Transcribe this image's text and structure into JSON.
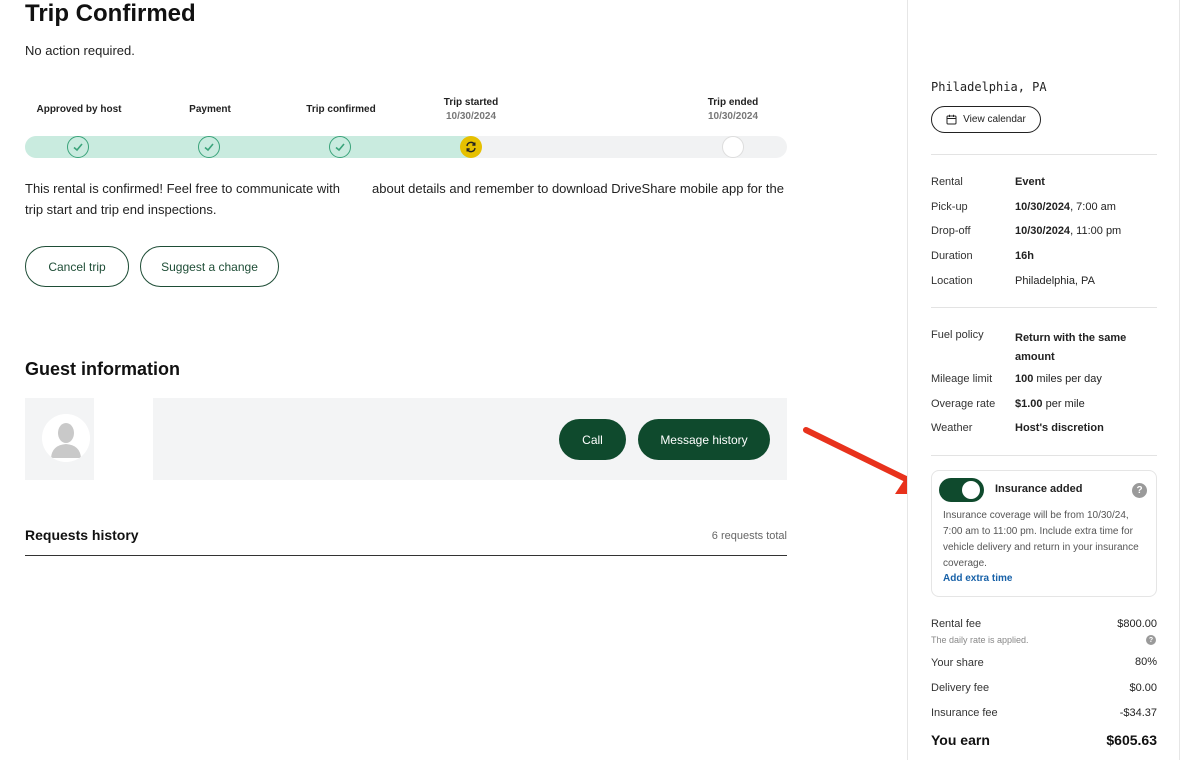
{
  "header": {
    "title": "Trip Confirmed",
    "subtitle": "No action required."
  },
  "progress": {
    "steps": [
      {
        "label": "Approved by host",
        "date": "",
        "state": "done"
      },
      {
        "label": "Payment",
        "date": "",
        "state": "done"
      },
      {
        "label": "Trip confirmed",
        "date": "",
        "state": "done"
      },
      {
        "label": "Trip started",
        "date": "10/30/2024",
        "state": "active"
      },
      {
        "label": "Trip ended",
        "date": "10/30/2024",
        "state": "pending"
      }
    ]
  },
  "message": {
    "part1": "This rental is confirmed! Feel free to communicate with",
    "part2": "about details and remember to download DriveShare mobile app for the trip start and trip end inspections."
  },
  "actions": {
    "cancel_label": "Cancel trip",
    "suggest_label": "Suggest a change"
  },
  "guest": {
    "section_title": "Guest information",
    "call_label": "Call",
    "message_history_label": "Message history"
  },
  "requests": {
    "title": "Requests history",
    "total": "6 requests total"
  },
  "sidebar": {
    "city": "Philadelphia, PA",
    "view_calendar_label": "View calendar",
    "details": [
      {
        "label": "Rental",
        "value_bold": "Event",
        "value_rest": ""
      },
      {
        "label": "Pick-up",
        "value_bold": "10/30/2024",
        "value_rest": ", 7:00 am"
      },
      {
        "label": "Drop-off",
        "value_bold": "10/30/2024",
        "value_rest": ", 11:00 pm"
      },
      {
        "label": "Duration",
        "value_bold": "16h",
        "value_rest": ""
      },
      {
        "label": "Location",
        "value_bold": "",
        "value_rest": "Philadelphia, PA"
      }
    ],
    "policies": [
      {
        "label": "Fuel policy",
        "value_bold": "Return with the same amount",
        "value_rest": ""
      },
      {
        "label": "Mileage limit",
        "value_bold": "100",
        "value_rest": " miles per day"
      },
      {
        "label": "Overage rate",
        "value_bold": "$1.00",
        "value_rest": " per mile"
      },
      {
        "label": "Weather",
        "value_bold": "Host's discretion",
        "value_rest": ""
      }
    ],
    "insurance": {
      "enabled": true,
      "title": "Insurance added",
      "description": "Insurance coverage will be from 10/30/24, 7:00 am to 11:00 pm. Include extra time for vehicle delivery and return in your insurance coverage.",
      "link": "Add extra time"
    },
    "fees": {
      "rental_fee_label": "Rental fee",
      "rental_fee_value": "$800.00",
      "rental_fee_note": "The daily rate is applied.",
      "share_label": "Your share",
      "share_value": "80%",
      "delivery_label": "Delivery fee",
      "delivery_value": "$0.00",
      "insurance_label": "Insurance fee",
      "insurance_value": "-$34.37",
      "earn_label": "You earn",
      "earn_value": "$605.63"
    }
  },
  "colors": {
    "brand_green": "#0f4a2d",
    "progress_fill": "#c9ebdf",
    "check_green": "#3aa37a",
    "active_yellow": "#e6c000",
    "arrow_red": "#e8321c",
    "link_blue": "#1761a8"
  }
}
